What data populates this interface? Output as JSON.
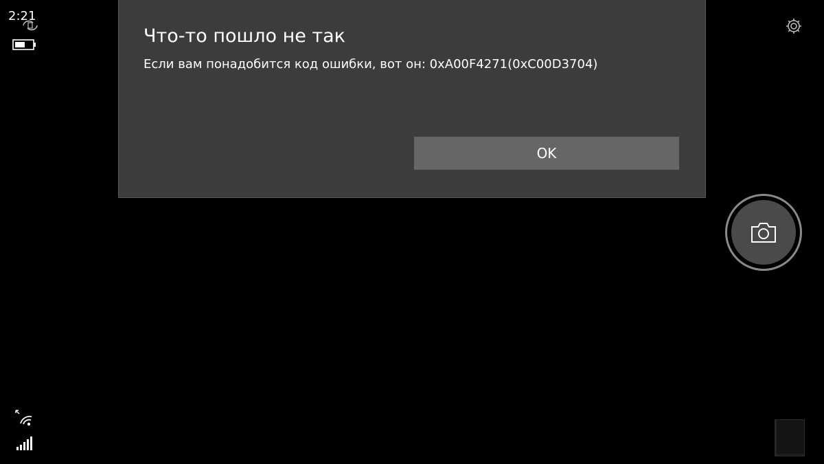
{
  "status_bar": {
    "time": "2:21",
    "icons": [
      "sync-icon",
      "battery-icon",
      "wifi-icon",
      "signal-icon"
    ]
  },
  "dialog": {
    "title": "Что-то пошло не так",
    "message": "Если вам понадобится код ошибки, вот он: 0xA00F4271(0xC00D3704)",
    "ok_label": "OK"
  },
  "camera": {
    "shutter_icon": "camera-icon",
    "settings_icon": "gear-icon",
    "gallery": "gallery-thumbnail"
  },
  "colors": {
    "background": "#000000",
    "dialog_background": "#3c3c3c",
    "button_background": "#666666",
    "text": "#ffffff"
  }
}
